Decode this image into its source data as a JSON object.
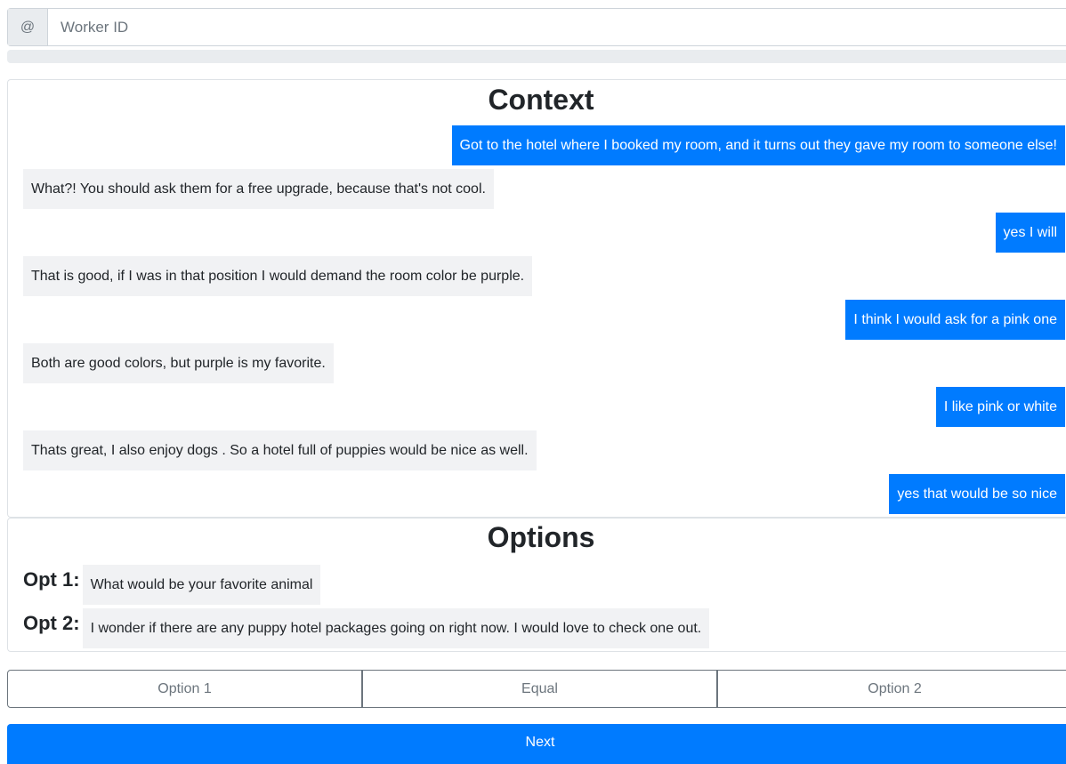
{
  "worker": {
    "prefix_symbol": "@",
    "placeholder": "Worker ID",
    "value": ""
  },
  "progress": {
    "fraction": 0
  },
  "context": {
    "title": "Context",
    "messages": [
      {
        "side": "right",
        "text": "Got to the hotel where I booked my room, and it turns out they gave my room to someone else!"
      },
      {
        "side": "left",
        "text": "What?! You should ask them for a free upgrade, because that's not cool."
      },
      {
        "side": "right",
        "text": "yes I will"
      },
      {
        "side": "left",
        "text": "That is good, if I was in that position I would demand the room color be purple."
      },
      {
        "side": "right",
        "text": "I think I would ask for a pink one"
      },
      {
        "side": "left",
        "text": "Both are good colors, but purple is my favorite."
      },
      {
        "side": "right",
        "text": "I like pink or white"
      },
      {
        "side": "left",
        "text": "Thats great, I also enjoy dogs . So a hotel full of puppies would be nice as well."
      },
      {
        "side": "right",
        "text": "yes that would be so nice"
      }
    ]
  },
  "options": {
    "title": "Options",
    "items": [
      {
        "label": "Opt 1:",
        "text": "What would be your favorite animal"
      },
      {
        "label": "Opt 2:",
        "text": "I wonder if there are any puppy hotel packages going on right now. I would love to check one out."
      }
    ]
  },
  "choices": {
    "option1_label": "Option 1",
    "equal_label": "Equal",
    "option2_label": "Option 2"
  },
  "next_label": "Next",
  "colors": {
    "primary": "#007bff",
    "bubble_left": "#f1f2f4",
    "border": "#dee2e6",
    "secondary": "#6c757d"
  }
}
